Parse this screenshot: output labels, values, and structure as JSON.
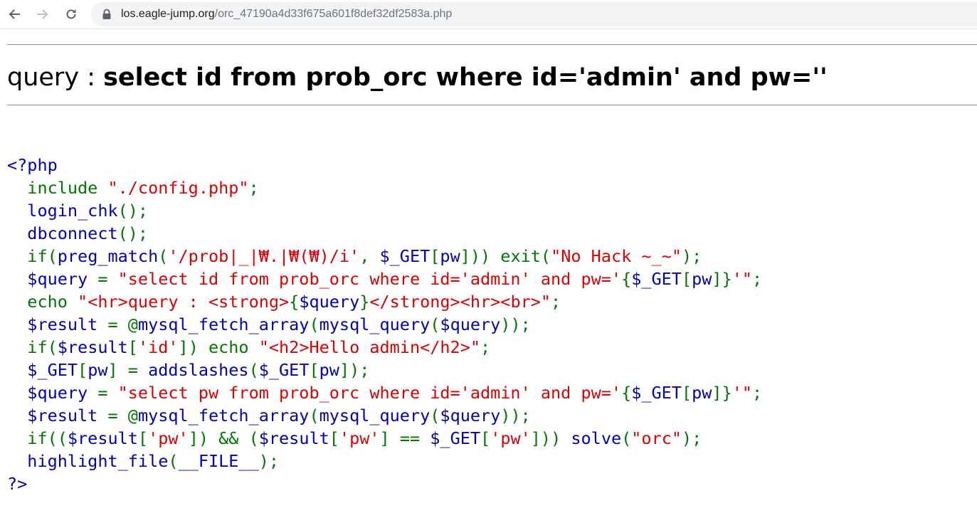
{
  "browser": {
    "url_host": "los.eagle-jump.org",
    "url_path": "/orc_47190a4d33f675a601f8def32df2583a.php"
  },
  "page": {
    "query_label": "query : ",
    "query_text": "select id from prob_orc where id='admin' and pw=''"
  },
  "code": {
    "lines": [
      [
        {
          "c": "def",
          "t": "<?php"
        }
      ],
      [
        {
          "c": "def",
          "t": "  "
        },
        {
          "c": "kw",
          "t": "include "
        },
        {
          "c": "str",
          "t": "\"./config.php\""
        },
        {
          "c": "kw",
          "t": ";"
        }
      ],
      [
        {
          "c": "def",
          "t": "  login_chk"
        },
        {
          "c": "kw",
          "t": "();"
        }
      ],
      [
        {
          "c": "def",
          "t": "  dbconnect"
        },
        {
          "c": "kw",
          "t": "();"
        }
      ],
      [
        {
          "c": "def",
          "t": "  "
        },
        {
          "c": "kw",
          "t": "if("
        },
        {
          "c": "def",
          "t": "preg_match"
        },
        {
          "c": "kw",
          "t": "("
        },
        {
          "c": "str",
          "t": "'/prob|_|₩.|₩(₩)/i'"
        },
        {
          "c": "kw",
          "t": ", "
        },
        {
          "c": "def",
          "t": "$_GET"
        },
        {
          "c": "kw",
          "t": "["
        },
        {
          "c": "def",
          "t": "pw"
        },
        {
          "c": "kw",
          "t": "])) exit("
        },
        {
          "c": "str",
          "t": "\"No Hack ~_~\""
        },
        {
          "c": "kw",
          "t": ");"
        }
      ],
      [
        {
          "c": "def",
          "t": "  $query "
        },
        {
          "c": "kw",
          "t": "= "
        },
        {
          "c": "str",
          "t": "\"select id from prob_orc where id='admin' and pw='"
        },
        {
          "c": "kw",
          "t": "{"
        },
        {
          "c": "def",
          "t": "$_GET"
        },
        {
          "c": "kw",
          "t": "["
        },
        {
          "c": "def",
          "t": "pw"
        },
        {
          "c": "kw",
          "t": "]}"
        },
        {
          "c": "str",
          "t": "'\""
        },
        {
          "c": "kw",
          "t": ";"
        }
      ],
      [
        {
          "c": "def",
          "t": "  "
        },
        {
          "c": "kw",
          "t": "echo "
        },
        {
          "c": "str",
          "t": "\"<hr>query : <strong>"
        },
        {
          "c": "kw",
          "t": "{"
        },
        {
          "c": "def",
          "t": "$query"
        },
        {
          "c": "kw",
          "t": "}"
        },
        {
          "c": "str",
          "t": "</strong><hr><br>\""
        },
        {
          "c": "kw",
          "t": ";"
        }
      ],
      [
        {
          "c": "def",
          "t": "  $result "
        },
        {
          "c": "kw",
          "t": "= @"
        },
        {
          "c": "def",
          "t": "mysql_fetch_array"
        },
        {
          "c": "kw",
          "t": "("
        },
        {
          "c": "def",
          "t": "mysql_query"
        },
        {
          "c": "kw",
          "t": "("
        },
        {
          "c": "def",
          "t": "$query"
        },
        {
          "c": "kw",
          "t": "));"
        }
      ],
      [
        {
          "c": "def",
          "t": "  "
        },
        {
          "c": "kw",
          "t": "if("
        },
        {
          "c": "def",
          "t": "$result"
        },
        {
          "c": "kw",
          "t": "["
        },
        {
          "c": "str",
          "t": "'id'"
        },
        {
          "c": "kw",
          "t": "]) echo "
        },
        {
          "c": "str",
          "t": "\"<h2>Hello admin</h2>\""
        },
        {
          "c": "kw",
          "t": ";"
        }
      ],
      [
        {
          "c": "def",
          "t": "  $_GET"
        },
        {
          "c": "kw",
          "t": "["
        },
        {
          "c": "def",
          "t": "pw"
        },
        {
          "c": "kw",
          "t": "] = "
        },
        {
          "c": "def",
          "t": "addslashes"
        },
        {
          "c": "kw",
          "t": "("
        },
        {
          "c": "def",
          "t": "$_GET"
        },
        {
          "c": "kw",
          "t": "["
        },
        {
          "c": "def",
          "t": "pw"
        },
        {
          "c": "kw",
          "t": "]);"
        }
      ],
      [
        {
          "c": "def",
          "t": "  $query "
        },
        {
          "c": "kw",
          "t": "= "
        },
        {
          "c": "str",
          "t": "\"select pw from prob_orc where id='admin' and pw='"
        },
        {
          "c": "kw",
          "t": "{"
        },
        {
          "c": "def",
          "t": "$_GET"
        },
        {
          "c": "kw",
          "t": "["
        },
        {
          "c": "def",
          "t": "pw"
        },
        {
          "c": "kw",
          "t": "]}"
        },
        {
          "c": "str",
          "t": "'\""
        },
        {
          "c": "kw",
          "t": ";"
        }
      ],
      [
        {
          "c": "def",
          "t": "  $result "
        },
        {
          "c": "kw",
          "t": "= @"
        },
        {
          "c": "def",
          "t": "mysql_fetch_array"
        },
        {
          "c": "kw",
          "t": "("
        },
        {
          "c": "def",
          "t": "mysql_query"
        },
        {
          "c": "kw",
          "t": "("
        },
        {
          "c": "def",
          "t": "$query"
        },
        {
          "c": "kw",
          "t": "));"
        }
      ],
      [
        {
          "c": "def",
          "t": "  "
        },
        {
          "c": "kw",
          "t": "if(("
        },
        {
          "c": "def",
          "t": "$result"
        },
        {
          "c": "kw",
          "t": "["
        },
        {
          "c": "str",
          "t": "'pw'"
        },
        {
          "c": "kw",
          "t": "]) && ("
        },
        {
          "c": "def",
          "t": "$result"
        },
        {
          "c": "kw",
          "t": "["
        },
        {
          "c": "str",
          "t": "'pw'"
        },
        {
          "c": "kw",
          "t": "] == "
        },
        {
          "c": "def",
          "t": "$_GET"
        },
        {
          "c": "kw",
          "t": "["
        },
        {
          "c": "str",
          "t": "'pw'"
        },
        {
          "c": "kw",
          "t": "])) "
        },
        {
          "c": "def",
          "t": "solve"
        },
        {
          "c": "kw",
          "t": "("
        },
        {
          "c": "str",
          "t": "\"orc\""
        },
        {
          "c": "kw",
          "t": ");"
        }
      ],
      [
        {
          "c": "def",
          "t": "  highlight_file"
        },
        {
          "c": "kw",
          "t": "("
        },
        {
          "c": "def",
          "t": "__FILE__"
        },
        {
          "c": "kw",
          "t": ");"
        }
      ],
      [
        {
          "c": "def",
          "t": "?>"
        }
      ]
    ]
  },
  "colors": {
    "php_default": "#0000BB",
    "php_keyword": "#007700",
    "php_string": "#DD0000"
  }
}
